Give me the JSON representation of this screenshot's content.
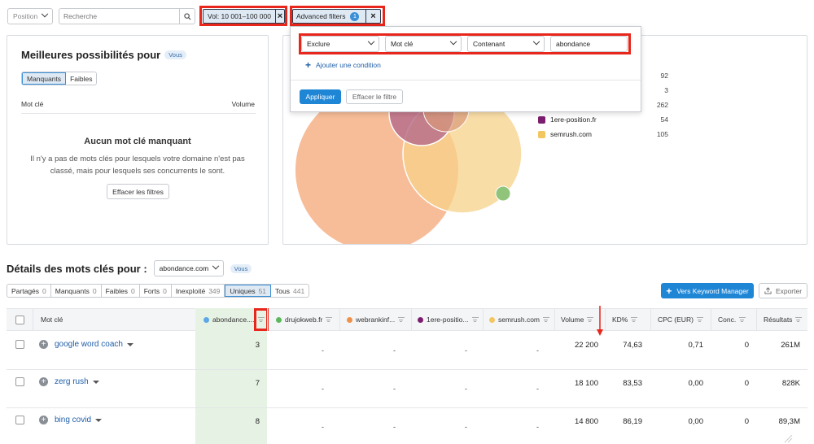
{
  "topbar": {
    "position_select": "Position",
    "search_placeholder": "Recherche",
    "vol_chip": "Vol: 10 001–100 000",
    "adv_chip": "Advanced filters",
    "adv_count": "1",
    "close_glyph": "×"
  },
  "adv_dropdown": {
    "cond_exclude": "Exclure",
    "cond_field": "Mot clé",
    "cond_op": "Contenant",
    "cond_value": "abondance",
    "add_condition": "Ajouter une condition",
    "apply": "Appliquer",
    "clear": "Effacer le filtre"
  },
  "left_card": {
    "title": "Meilleures possibilités pour",
    "badge": "Vous",
    "tab_missing": "Manquants",
    "tab_weak": "Faibles",
    "col_keyword": "Mot clé",
    "col_volume": "Volume",
    "empty_title": "Aucun mot clé manquant",
    "empty_text": "Il n'y a pas de mots clés pour lesquels votre domaine n'est pas classé, mais pour lesquels ses concurrents le sont.",
    "clear_filters": "Effacer les filtres"
  },
  "venn_legend": [
    {
      "label": "",
      "value": "92",
      "color": "#ffffff"
    },
    {
      "label": "",
      "value": "3",
      "color": "#ffffff"
    },
    {
      "label": "",
      "value": "262",
      "color": "#ffffff"
    },
    {
      "label": "1ere-position.fr",
      "value": "54",
      "color": "#7b1e6e"
    },
    {
      "label": "semrush.com",
      "value": "105",
      "color": "#f2c660"
    }
  ],
  "details": {
    "title": "Détails des mots clés pour :",
    "domain": "abondance.com",
    "badge": "Vous",
    "tabs": [
      {
        "label": "Partagés",
        "count": "0"
      },
      {
        "label": "Manquants",
        "count": "0"
      },
      {
        "label": "Faibles",
        "count": "0"
      },
      {
        "label": "Forts",
        "count": "0"
      },
      {
        "label": "Inexploité",
        "count": "349"
      },
      {
        "label": "Uniques",
        "count": "51"
      },
      {
        "label": "Tous",
        "count": "441"
      }
    ],
    "km_button": "Vers Keyword Manager",
    "export_button": "Exporter"
  },
  "table": {
    "headers": {
      "keyword": "Mot clé",
      "d1": "abondance....",
      "d2": "drujokweb.fr",
      "d3": "webrankinf...",
      "d4": "1ere-positio...",
      "d5": "semrush.com",
      "volume": "Volume",
      "kd": "KD%",
      "cpc": "CPC (EUR)",
      "conc": "Conc.",
      "results": "Résultats"
    },
    "header_colors": {
      "d1": "#5ca7e6",
      "d2": "#5cb85c",
      "d3": "#f0914a",
      "d4": "#7b1e6e",
      "d5": "#f2c660"
    },
    "rows": [
      {
        "keyword": "google word coach",
        "d1": "3",
        "d2": "-",
        "d3": "-",
        "d4": "-",
        "d5": "-",
        "volume": "22 200",
        "kd": "74,63",
        "cpc": "0,71",
        "conc": "0",
        "results": "261M"
      },
      {
        "keyword": "zerg rush",
        "d1": "7",
        "d2": "-",
        "d3": "-",
        "d4": "-",
        "d5": "-",
        "volume": "18 100",
        "kd": "83,53",
        "cpc": "0,00",
        "conc": "0",
        "results": "828K"
      },
      {
        "keyword": "bing covid",
        "d1": "8",
        "d2": "-",
        "d3": "-",
        "d4": "-",
        "d5": "-",
        "volume": "14 800",
        "kd": "86,19",
        "cpc": "0,00",
        "conc": "0",
        "results": "89,3M"
      }
    ]
  }
}
